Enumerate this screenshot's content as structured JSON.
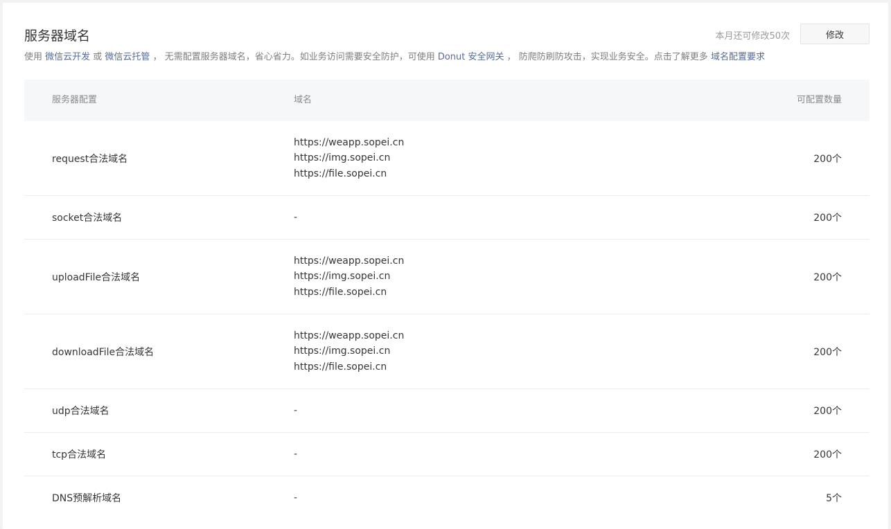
{
  "header": {
    "title": "服务器域名",
    "quota_text": "本月还可修改50次",
    "modify_label": "修改"
  },
  "description": {
    "prefix": "使用 ",
    "link_weixin_dev": "微信云开发",
    "or": " 或 ",
    "link_weixin_host": "微信云托管",
    "middle": " ， 无需配置服务器域名，省心省力。如业务访问需要安全防护，可使用 ",
    "link_donut": "Donut 安全网关",
    "middle2": " ， 防爬防刷防攻击，实现业务安全。点击了解更多 ",
    "link_requirements": "域名配置要求"
  },
  "table": {
    "columns": [
      "服务器配置",
      "域名",
      "可配置数量"
    ],
    "rows": [
      {
        "config": "request合法域名",
        "domains": [
          "https://weapp.sopei.cn",
          "https://img.sopei.cn",
          "https://file.sopei.cn"
        ],
        "count": "200个"
      },
      {
        "config": "socket合法域名",
        "domains": [
          "-"
        ],
        "count": "200个"
      },
      {
        "config": "uploadFile合法域名",
        "domains": [
          "https://weapp.sopei.cn",
          "https://img.sopei.cn",
          "https://file.sopei.cn"
        ],
        "count": "200个"
      },
      {
        "config": "downloadFile合法域名",
        "domains": [
          "https://weapp.sopei.cn",
          "https://img.sopei.cn",
          "https://file.sopei.cn"
        ],
        "count": "200个"
      },
      {
        "config": "udp合法域名",
        "domains": [
          "-"
        ],
        "count": "200个"
      },
      {
        "config": "tcp合法域名",
        "domains": [
          "-"
        ],
        "count": "200个"
      },
      {
        "config": "DNS预解析域名",
        "domains": [
          "-"
        ],
        "count": "5个"
      }
    ]
  },
  "colors": {
    "link": "#576b95",
    "header_bg": "#f6f7f9",
    "page_bg": "#f2f2f2"
  }
}
